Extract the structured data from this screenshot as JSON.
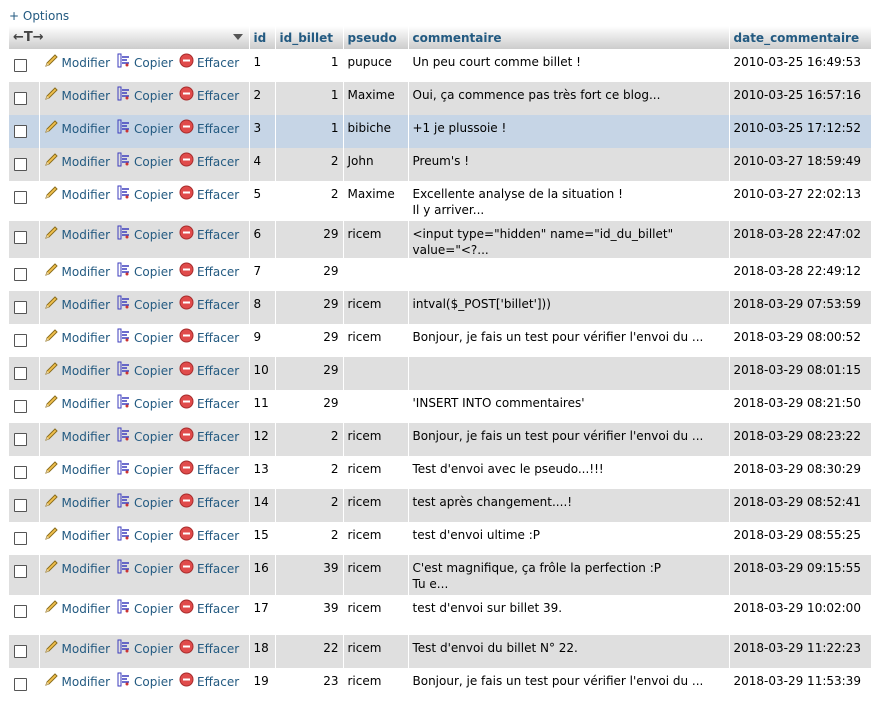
{
  "options_label": "+ Options",
  "header": {
    "arrows": "←T→",
    "columns": [
      "id",
      "id_billet",
      "pseudo",
      "commentaire",
      "date_commentaire"
    ]
  },
  "action_labels": {
    "edit": "Modifier",
    "copy": "Copier",
    "delete": "Effacer"
  },
  "rows": [
    {
      "id": "1",
      "id_billet": "1",
      "pseudo": "pupuce",
      "commentaire": "Un peu court comme billet !",
      "date": "2010-03-25 16:49:53"
    },
    {
      "id": "2",
      "id_billet": "1",
      "pseudo": "Maxime",
      "commentaire": "Oui, ça commence pas très fort ce blog...",
      "date": "2010-03-25 16:57:16"
    },
    {
      "id": "3",
      "id_billet": "1",
      "pseudo": "bibiche",
      "commentaire": "+1 je plussoie !",
      "date": "2010-03-25 17:12:52"
    },
    {
      "id": "4",
      "id_billet": "2",
      "pseudo": "John",
      "commentaire": "Preum's !",
      "date": "2010-03-27 18:59:49"
    },
    {
      "id": "5",
      "id_billet": "2",
      "pseudo": "Maxime",
      "commentaire": "Excellente analyse de la situation !\nIl y arriver...",
      "date": "2010-03-27 22:02:13"
    },
    {
      "id": "6",
      "id_billet": "29",
      "pseudo": "ricem",
      "commentaire": "<input type=\"hidden\" name=\"id_du_billet\" value=\"<?...",
      "date": "2018-03-28 22:47:02"
    },
    {
      "id": "7",
      "id_billet": "29",
      "pseudo": "",
      "commentaire": "",
      "date": "2018-03-28 22:49:12"
    },
    {
      "id": "8",
      "id_billet": "29",
      "pseudo": "ricem",
      "commentaire": "intval($_POST['billet']))",
      "date": "2018-03-29 07:53:59"
    },
    {
      "id": "9",
      "id_billet": "29",
      "pseudo": "ricem",
      "commentaire": "Bonjour, je fais un test pour vérifier l'envoi du ...",
      "date": "2018-03-29 08:00:52"
    },
    {
      "id": "10",
      "id_billet": "29",
      "pseudo": "",
      "commentaire": "",
      "date": "2018-03-29 08:01:15"
    },
    {
      "id": "11",
      "id_billet": "29",
      "pseudo": "",
      "commentaire": "'INSERT INTO commentaires'",
      "date": "2018-03-29 08:21:50"
    },
    {
      "id": "12",
      "id_billet": "2",
      "pseudo": "ricem",
      "commentaire": "Bonjour, je fais un test pour vérifier l'envoi du ...",
      "date": "2018-03-29 08:23:22"
    },
    {
      "id": "13",
      "id_billet": "2",
      "pseudo": "ricem",
      "commentaire": "Test d'envoi avec le pseudo...!!!",
      "date": "2018-03-29 08:30:29"
    },
    {
      "id": "14",
      "id_billet": "2",
      "pseudo": "ricem",
      "commentaire": "test après changement....!",
      "date": "2018-03-29 08:52:41"
    },
    {
      "id": "15",
      "id_billet": "2",
      "pseudo": "ricem",
      "commentaire": "test d'envoi ultime :P",
      "date": "2018-03-29 08:55:25"
    },
    {
      "id": "16",
      "id_billet": "39",
      "pseudo": "ricem",
      "commentaire": "C'est magnifique, ça frôle la perfection :P\nTu e...",
      "date": "2018-03-29 09:15:55"
    },
    {
      "id": "17",
      "id_billet": "39",
      "pseudo": "ricem",
      "commentaire": "test d'envoi sur billet 39.",
      "date": "2018-03-29 10:02:00"
    },
    {
      "id": "18",
      "id_billet": "22",
      "pseudo": "ricem",
      "commentaire": "Test d'envoi du billet N° 22.",
      "date": "2018-03-29 11:22:23"
    },
    {
      "id": "19",
      "id_billet": "23",
      "pseudo": "ricem",
      "commentaire": "Bonjour, je fais un test pour vérifier l'envoi du ...",
      "date": "2018-03-29 11:53:39"
    }
  ],
  "marked_row_index": 2,
  "colors": {
    "link": "#235a81",
    "row_even": "#dfdfdf",
    "row_marked": "#c6d5e6",
    "delete": "#e04b4b"
  }
}
